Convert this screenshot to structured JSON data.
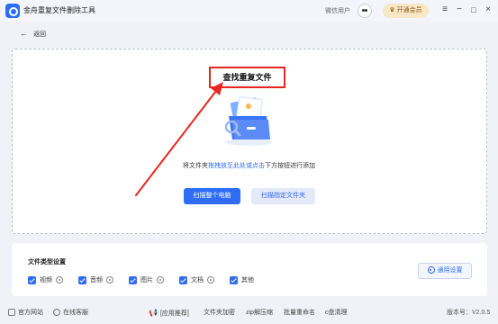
{
  "app": {
    "title": "金舟重复文件删除工具"
  },
  "header": {
    "user_name": "微信用户",
    "vip_label": "开通会员",
    "menu_icon": "menu-icon",
    "minimize_icon": "minimize-icon",
    "maximize_icon": "maximize-icon",
    "close_icon": "close-icon"
  },
  "nav": {
    "back_label": "返回"
  },
  "main": {
    "find_label": "查找重复文件",
    "hint_prefix": "将文件夹",
    "hint_link": "拖拽放至此处或点击",
    "hint_suffix": "下方按钮进行添加",
    "scan_pc_label": "扫描整个电脑",
    "scan_folder_label": "扫描指定文件夹"
  },
  "types": {
    "title": "文件类型设置",
    "items": [
      {
        "label": "视频",
        "checked": true
      },
      {
        "label": "音频",
        "checked": true
      },
      {
        "label": "图片",
        "checked": true
      },
      {
        "label": "文档",
        "checked": true
      },
      {
        "label": "其他",
        "checked": true
      }
    ],
    "general_settings_label": "通用设置"
  },
  "footer": {
    "website": "官方网站",
    "support": "在线客服",
    "recommend_label": "[应用推荐]",
    "links": [
      "文件夹加密",
      "zip解压缩",
      "批量重命名",
      "c盘清理"
    ],
    "version": "版本号：V2.0.5"
  },
  "colors": {
    "accent": "#2f6cf6",
    "highlight_red": "#e8261f",
    "vip_bg": "#f8e8c8"
  }
}
